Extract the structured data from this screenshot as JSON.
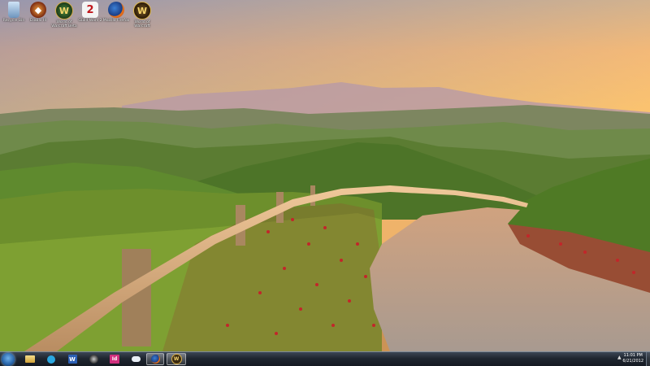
{
  "desktop": {
    "icons": [
      {
        "label": "Recycle Bin",
        "icon": "recycle-bin-icon"
      },
      {
        "label": "Diablo III",
        "icon": "diablo-iii-icon"
      },
      {
        "label": "World of Warcraft Beta",
        "icon": "wow-beta-icon"
      },
      {
        "label": "Guild Wars 2",
        "icon": "guild-wars-2-icon"
      },
      {
        "label": "Mozilla Firefox",
        "icon": "firefox-icon"
      },
      {
        "label": "World of Warcraft",
        "icon": "wow-icon"
      }
    ]
  },
  "taskbar": {
    "start_icon": "windows-orb-icon",
    "pinned": [
      {
        "icon": "windows-explorer-icon"
      },
      {
        "icon": "skype-icon"
      },
      {
        "icon": "microsoft-word-icon",
        "glyph": "W"
      },
      {
        "icon": "steam-icon"
      },
      {
        "icon": "adobe-indesign-icon",
        "glyph": "Id"
      },
      {
        "icon": "cloud-app-icon"
      },
      {
        "icon": "firefox-icon"
      },
      {
        "icon": "world-of-warcraft-icon",
        "glyph": "W"
      }
    ],
    "tray_arrow": "▲",
    "clock_time": "11:01 PM",
    "clock_date": "6/21/2012"
  }
}
